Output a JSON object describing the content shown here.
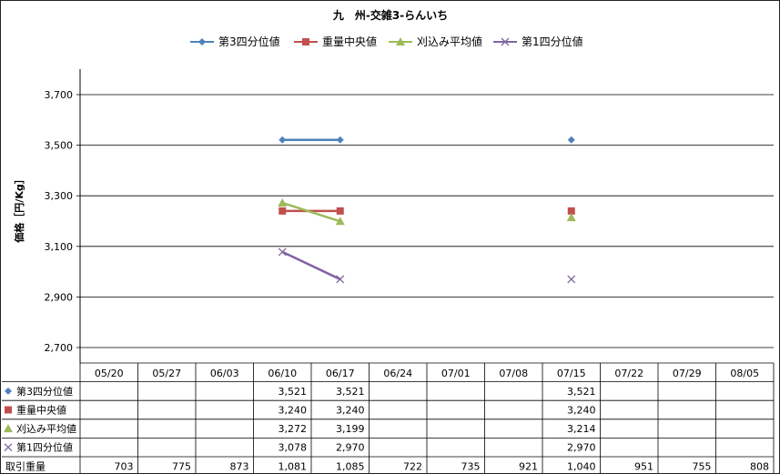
{
  "chart_data": {
    "type": "line",
    "title": "九　州-交雑3-らんいち",
    "ylabel": "価格［円/Kg］",
    "ylim": [
      2700,
      3700
    ],
    "yticks": [
      2700,
      2900,
      3100,
      3300,
      3500,
      3700
    ],
    "ytick_labels": [
      "2,700",
      "2,900",
      "3,100",
      "3,300",
      "3,500",
      "3,700"
    ],
    "grid": true,
    "legend_position": "top",
    "categories": [
      "05/20",
      "05/27",
      "06/03",
      "06/10",
      "06/17",
      "06/24",
      "07/01",
      "07/08",
      "07/15",
      "07/22",
      "07/29",
      "08/05"
    ],
    "series": [
      {
        "name": "第3四分位値",
        "color": "#4F81BD",
        "marker": "diamond",
        "values": [
          null,
          null,
          null,
          3521,
          3521,
          null,
          null,
          null,
          3521,
          null,
          null,
          null
        ],
        "labels": [
          "",
          "",
          "",
          "3,521",
          "3,521",
          "",
          "",
          "",
          "3,521",
          "",
          "",
          ""
        ]
      },
      {
        "name": "重量中央値",
        "color": "#C0504D",
        "marker": "square",
        "values": [
          null,
          null,
          null,
          3240,
          3240,
          null,
          null,
          null,
          3240,
          null,
          null,
          null
        ],
        "labels": [
          "",
          "",
          "",
          "3,240",
          "3,240",
          "",
          "",
          "",
          "3,240",
          "",
          "",
          ""
        ]
      },
      {
        "name": "刈込み平均値",
        "color": "#9BBB59",
        "marker": "triangle",
        "values": [
          null,
          null,
          null,
          3272,
          3199,
          null,
          null,
          null,
          3214,
          null,
          null,
          null
        ],
        "labels": [
          "",
          "",
          "",
          "3,272",
          "3,199",
          "",
          "",
          "",
          "3,214",
          "",
          "",
          ""
        ]
      },
      {
        "name": "第1四分位値",
        "color": "#8064A2",
        "marker": "x",
        "values": [
          null,
          null,
          null,
          3078,
          2970,
          null,
          null,
          null,
          2970,
          null,
          null,
          null
        ],
        "labels": [
          "",
          "",
          "",
          "3,078",
          "2,970",
          "",
          "",
          "",
          "2,970",
          "",
          "",
          ""
        ]
      }
    ],
    "table_extra_row": {
      "name": "取引重量",
      "values": [
        703,
        775,
        873,
        1081,
        1085,
        722,
        735,
        921,
        1040,
        951,
        755,
        808
      ],
      "labels": [
        "703",
        "775",
        "873",
        "1,081",
        "1,085",
        "722",
        "735",
        "921",
        "1,040",
        "951",
        "755",
        "808"
      ]
    }
  }
}
